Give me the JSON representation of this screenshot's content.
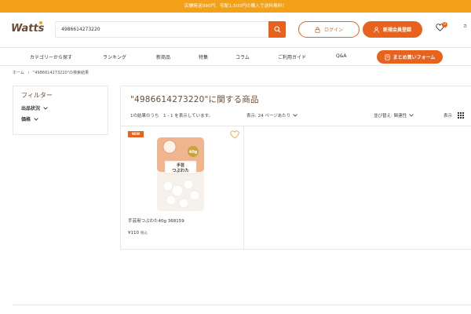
{
  "banner": {
    "text": "店舗発送990円、宅配1,500円の購入で送料無料！"
  },
  "header": {
    "logo": "Watts",
    "search_value": "4986614273220",
    "login_label": "ログイン",
    "register_label": "新規会員登録",
    "favorites_count": "0",
    "cart_label": "カ"
  },
  "nav": {
    "items": [
      "カテゴリーから探す",
      "ランキング",
      "新商品",
      "特集",
      "コラム",
      "ご利用ガイド",
      "Q&A"
    ],
    "cta_label": "まとめ買いフォーム"
  },
  "breadcrumb": {
    "home": "ホーム",
    "separator": "›",
    "current": "\"4986614273220\"の検索結果"
  },
  "sidebar": {
    "title": "フィルター",
    "filters": [
      "出品状況",
      "価格"
    ]
  },
  "results": {
    "title": "\"4986614273220\"に関する商品",
    "count_text": "1の結果のうち　1 - 1 を表示しています。",
    "per_page": "表示: 24 ページあたり",
    "sort": "並び替え: 関連性",
    "view_label": "表示"
  },
  "products": [
    {
      "badge": "NEW",
      "name": "手芸用つぶわた40g 368159",
      "price": "¥110",
      "tax": "税込",
      "package_text": "手芸\nつぶわた",
      "package_weight": "40g"
    }
  ],
  "colors": {
    "brand_orange": "#e8611d",
    "banner_yellow": "#f4a11a",
    "brown": "#6b4a30"
  }
}
